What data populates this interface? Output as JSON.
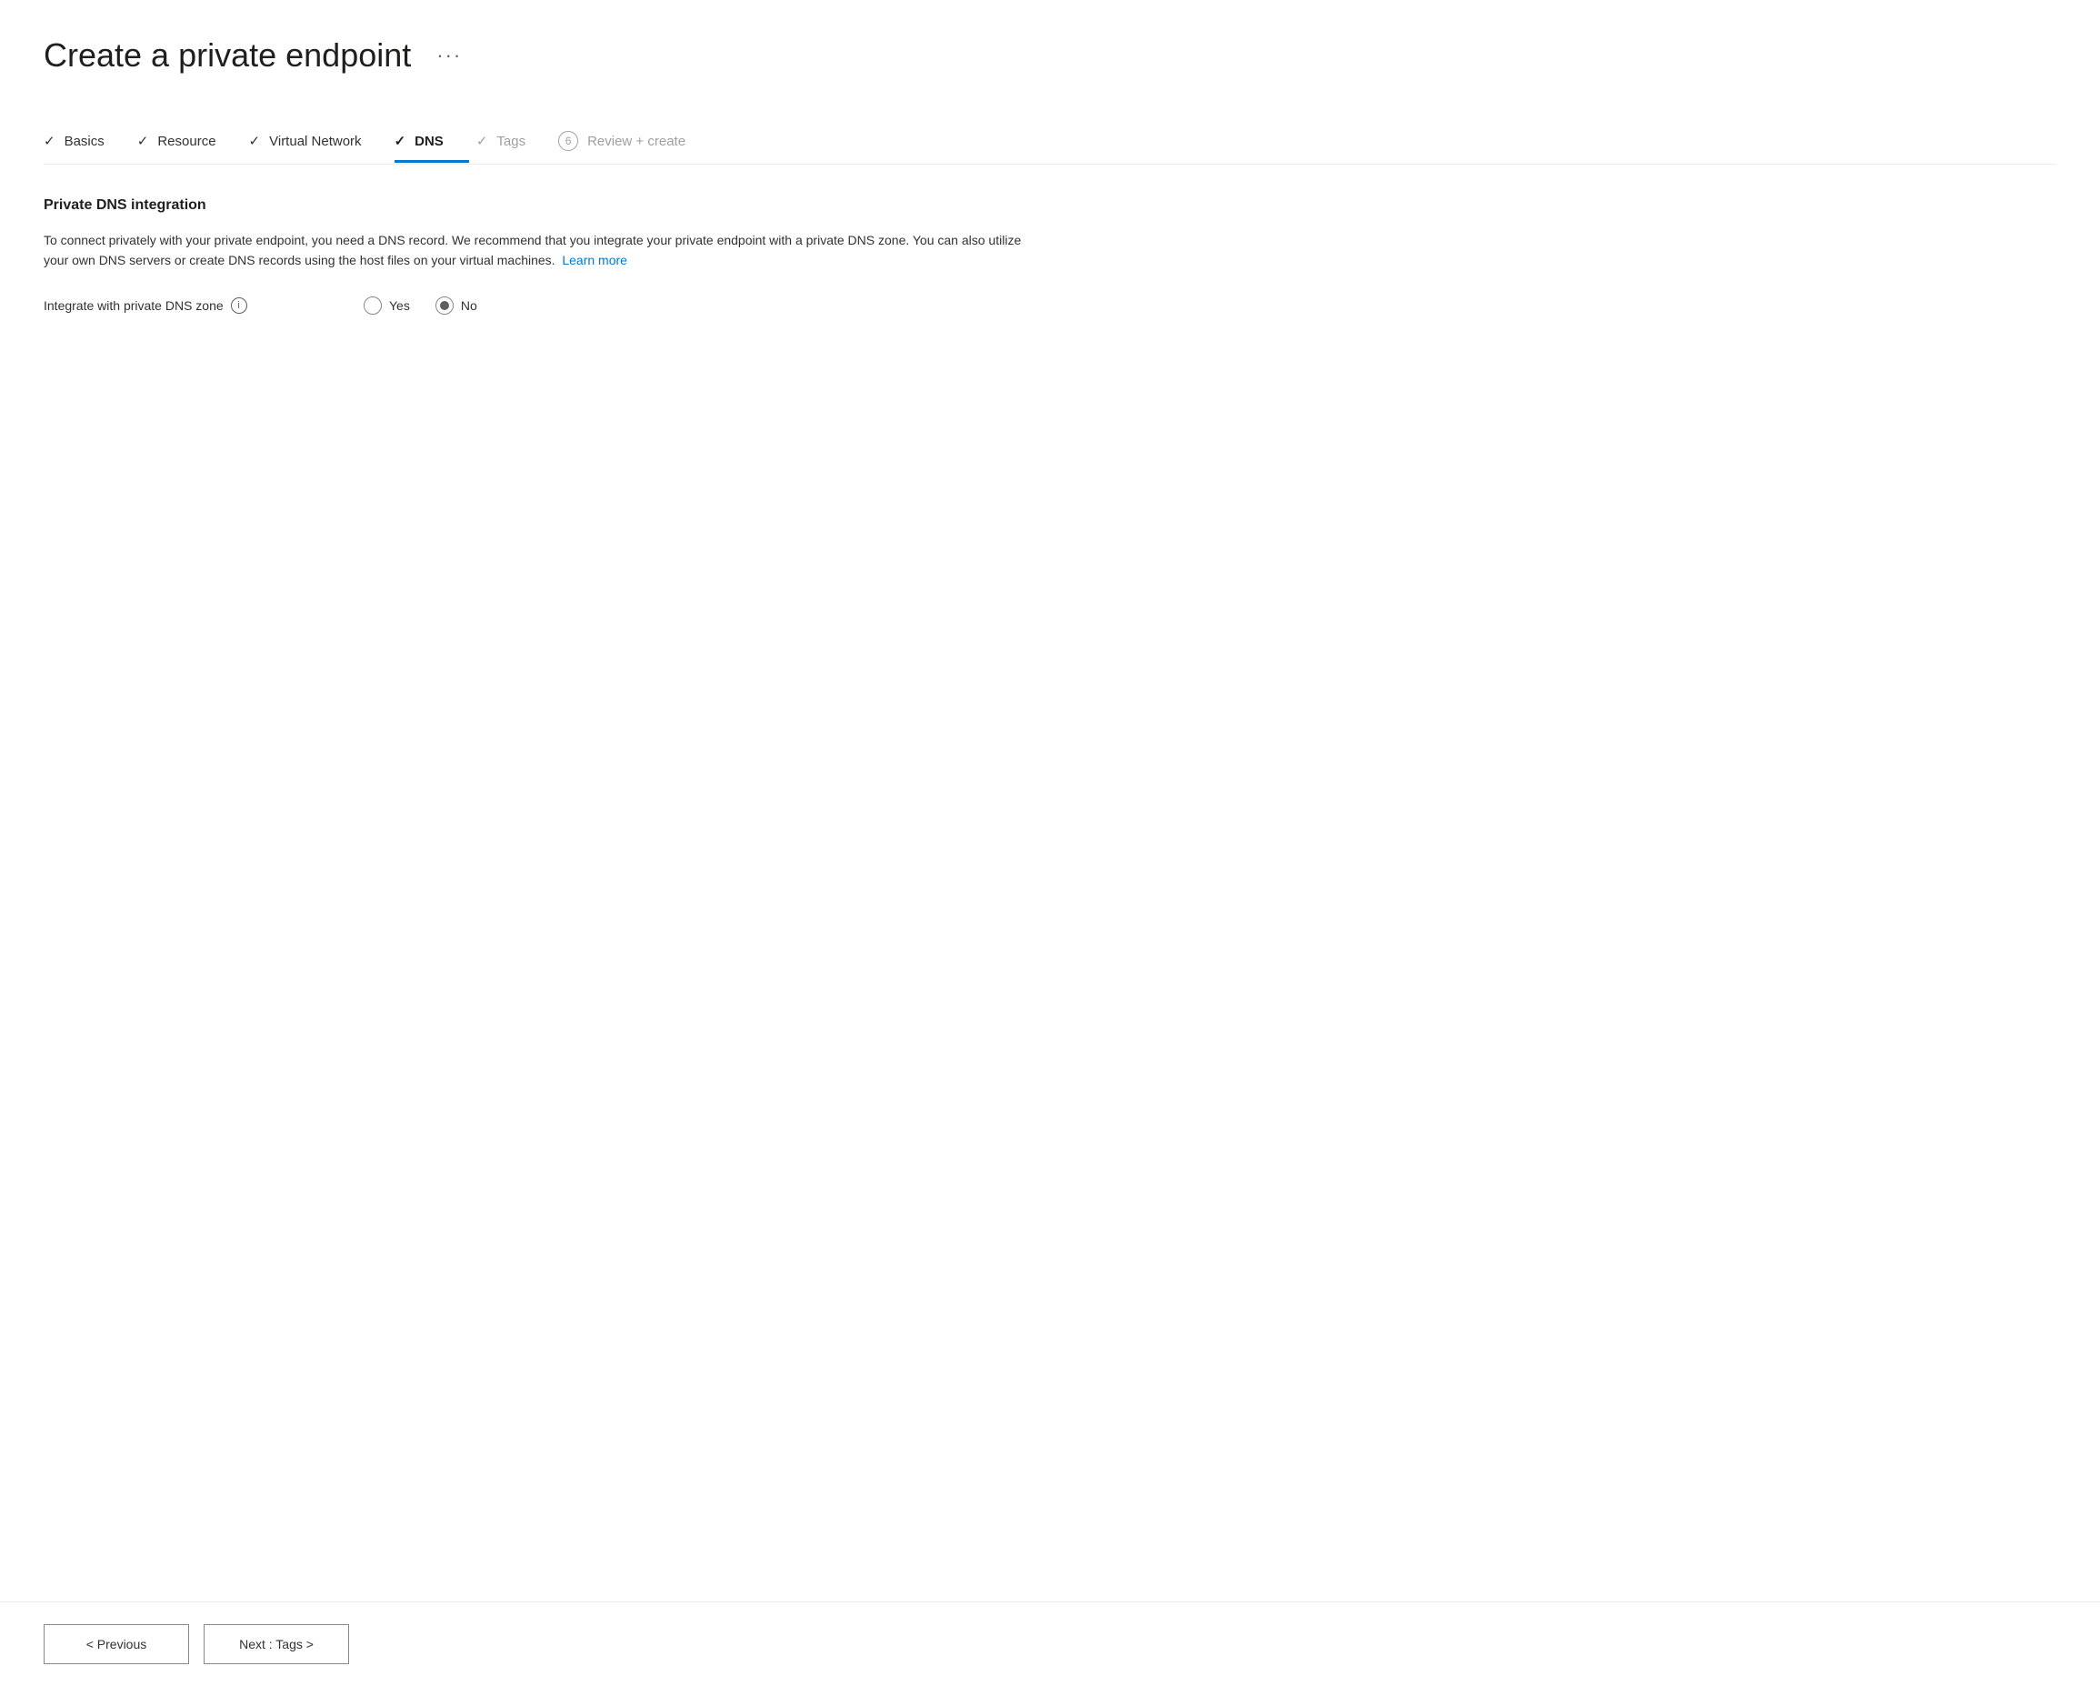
{
  "page": {
    "title": "Create a private endpoint",
    "ellipsis": "···"
  },
  "tabs": [
    {
      "id": "basics",
      "label": "Basics",
      "state": "completed",
      "check": "✓",
      "number": null
    },
    {
      "id": "resource",
      "label": "Resource",
      "state": "completed",
      "check": "✓",
      "number": null
    },
    {
      "id": "virtual-network",
      "label": "Virtual Network",
      "state": "completed",
      "check": "✓",
      "number": null
    },
    {
      "id": "dns",
      "label": "DNS",
      "state": "active",
      "check": "✓",
      "number": null
    },
    {
      "id": "tags",
      "label": "Tags",
      "state": "disabled",
      "check": "✓",
      "number": null
    },
    {
      "id": "review-create",
      "label": "Review + create",
      "state": "disabled",
      "check": null,
      "number": "6"
    }
  ],
  "content": {
    "section_title": "Private DNS integration",
    "description_part1": "To connect privately with your private endpoint, you need a DNS record. We recommend that you integrate your private endpoint with a private DNS zone. You can also utilize your own DNS servers or create DNS records using the host files on your virtual machines.",
    "learn_more_label": "Learn more",
    "form_label": "Integrate with private DNS zone",
    "radio_yes": "Yes",
    "radio_no": "No",
    "selected_radio": "no"
  },
  "footer": {
    "previous_label": "< Previous",
    "next_label": "Next : Tags >"
  }
}
